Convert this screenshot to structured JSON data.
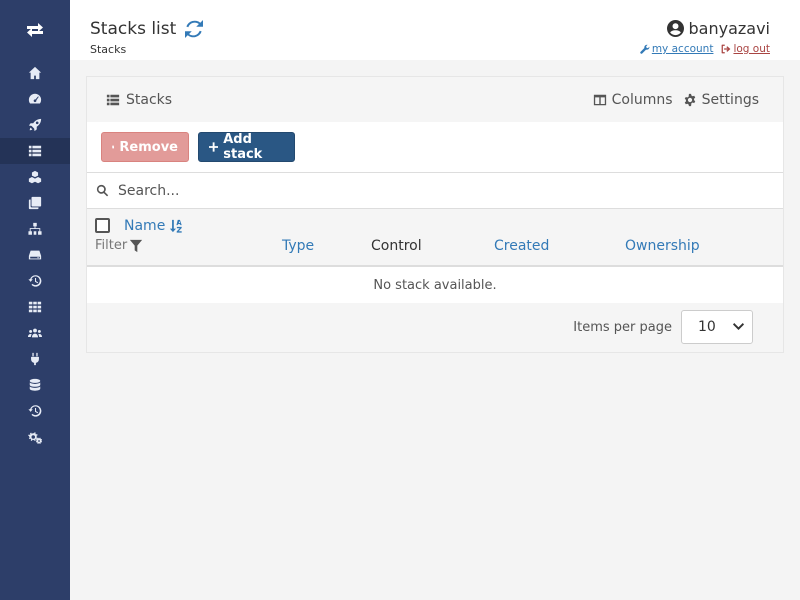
{
  "sidebar": {
    "items": [
      {
        "icon": "home-icon"
      },
      {
        "icon": "dashboard-icon"
      },
      {
        "icon": "rocket-icon"
      },
      {
        "icon": "list-icon",
        "active": true
      },
      {
        "icon": "cubes-icon"
      },
      {
        "icon": "clone-icon"
      },
      {
        "icon": "sitemap-icon"
      },
      {
        "icon": "hdd-icon"
      },
      {
        "icon": "history-icon"
      },
      {
        "icon": "th-icon"
      },
      {
        "icon": "users-icon"
      },
      {
        "icon": "plug-icon"
      },
      {
        "icon": "database-icon"
      },
      {
        "icon": "history-icon"
      },
      {
        "icon": "cogs-icon"
      }
    ]
  },
  "header": {
    "title": "Stacks list",
    "breadcrumb": "Stacks",
    "username": "banyazavi",
    "my_account": "my account",
    "log_out": "log out"
  },
  "widget": {
    "title": "Stacks",
    "columns_label": "Columns",
    "settings_label": "Settings",
    "remove_label": "Remove",
    "add_label": "Add stack",
    "search_placeholder": "Search...",
    "columns": {
      "name": "Name",
      "filter": "Filter",
      "type": "Type",
      "control": "Control",
      "created": "Created",
      "ownership": "Ownership"
    },
    "empty_message": "No stack available.",
    "items_per_page_label": "Items per page",
    "items_per_page_value": "10"
  },
  "colors": {
    "sidebar": "#2d3e69",
    "primary": "#2a5784",
    "danger": "#e29b99",
    "link": "#337ab7"
  }
}
